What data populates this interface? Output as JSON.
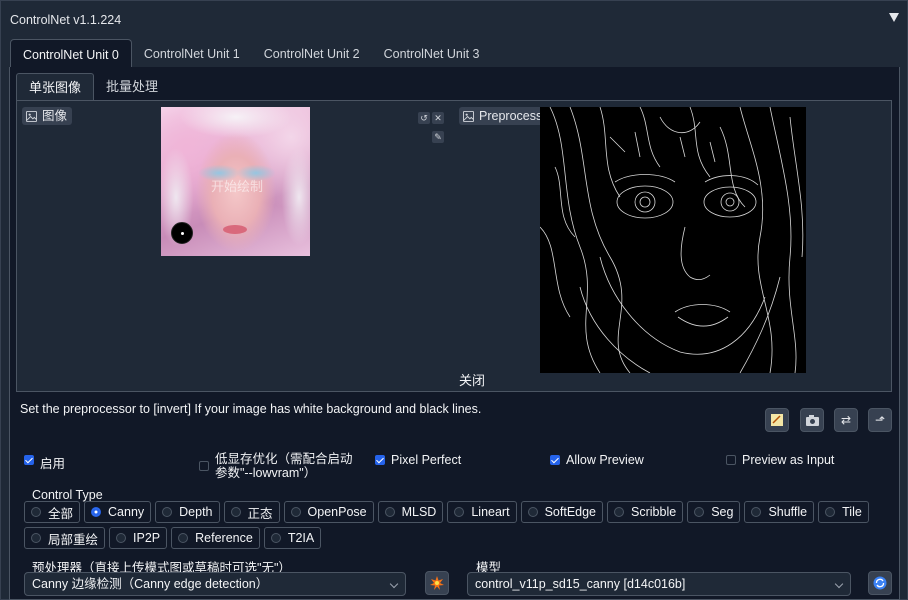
{
  "panel": {
    "title": "ControlNet v1.1.224"
  },
  "unit_tabs": [
    "ControlNet Unit 0",
    "ControlNet Unit 1",
    "ControlNet Unit 2",
    "ControlNet Unit 3"
  ],
  "sub_tabs": [
    "单张图像",
    "批量处理"
  ],
  "image_panel": {
    "input_label": "图像",
    "preview_label": "Preprocessor Preview",
    "watermark": "开始绘制",
    "close_label": "关闭"
  },
  "hint": "Set the preprocessor to [invert] If your image has white background and black lines.",
  "options": {
    "enable": {
      "label": "启用",
      "checked": true
    },
    "low_vram": {
      "label_line1": "低显存优化（需配合启动",
      "label_line2": "参数\"--lowvram\"）",
      "checked": false
    },
    "pixel_perfect": {
      "label": "Pixel Perfect",
      "checked": true
    },
    "allow_preview": {
      "label": "Allow Preview",
      "checked": true
    },
    "preview_as_input": {
      "label": "Preview as Input",
      "checked": false
    }
  },
  "control_type": {
    "label": "Control Type",
    "row1": [
      "全部",
      "Canny",
      "Depth",
      "正态",
      "OpenPose",
      "MLSD",
      "Lineart",
      "SoftEdge",
      "Scribble",
      "Seg",
      "Shuffle",
      "Tile"
    ],
    "row2": [
      "局部重绘",
      "IP2P",
      "Reference",
      "T2IA"
    ],
    "selected": "Canny"
  },
  "preprocessor": {
    "label": "预处理器（直接上传模式图或草稿时可选\"无\"）",
    "value": "Canny 边缘检测（Canny edge detection）"
  },
  "model": {
    "label": "模型",
    "value": "control_v11p_sd15_canny [d14c016b]"
  },
  "colors": {
    "accent": "#2563eb",
    "panel": "#1f2937",
    "body": "#111827"
  }
}
